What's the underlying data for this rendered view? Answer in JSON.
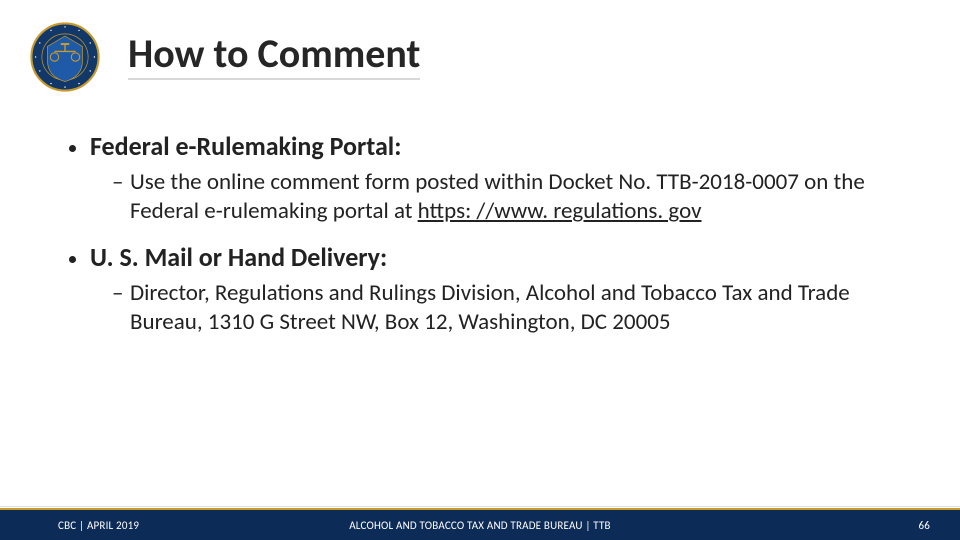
{
  "title": "How to Comment",
  "bullets": [
    {
      "label": "Federal e-Rulemaking Portal:",
      "sub": {
        "pre": "Use the online comment form posted within Docket No. TTB-2018-0007 on the Federal e-rulemaking portal at ",
        "link": "https: //www. regulations. gov",
        "post": ""
      }
    },
    {
      "label": "U. S. Mail or Hand Delivery:",
      "sub": {
        "pre": "Director, Regulations and Rulings Division, Alcohol and Tobacco Tax and Trade Bureau, 1310 G Street NW, Box 12, Washington, DC 20005",
        "link": "",
        "post": ""
      }
    }
  ],
  "footer": {
    "left": "CBC | APRIL 2019",
    "center": "ALCOHOL AND TOBACCO TAX AND TRADE BUREAU | TTB",
    "right": "66"
  }
}
